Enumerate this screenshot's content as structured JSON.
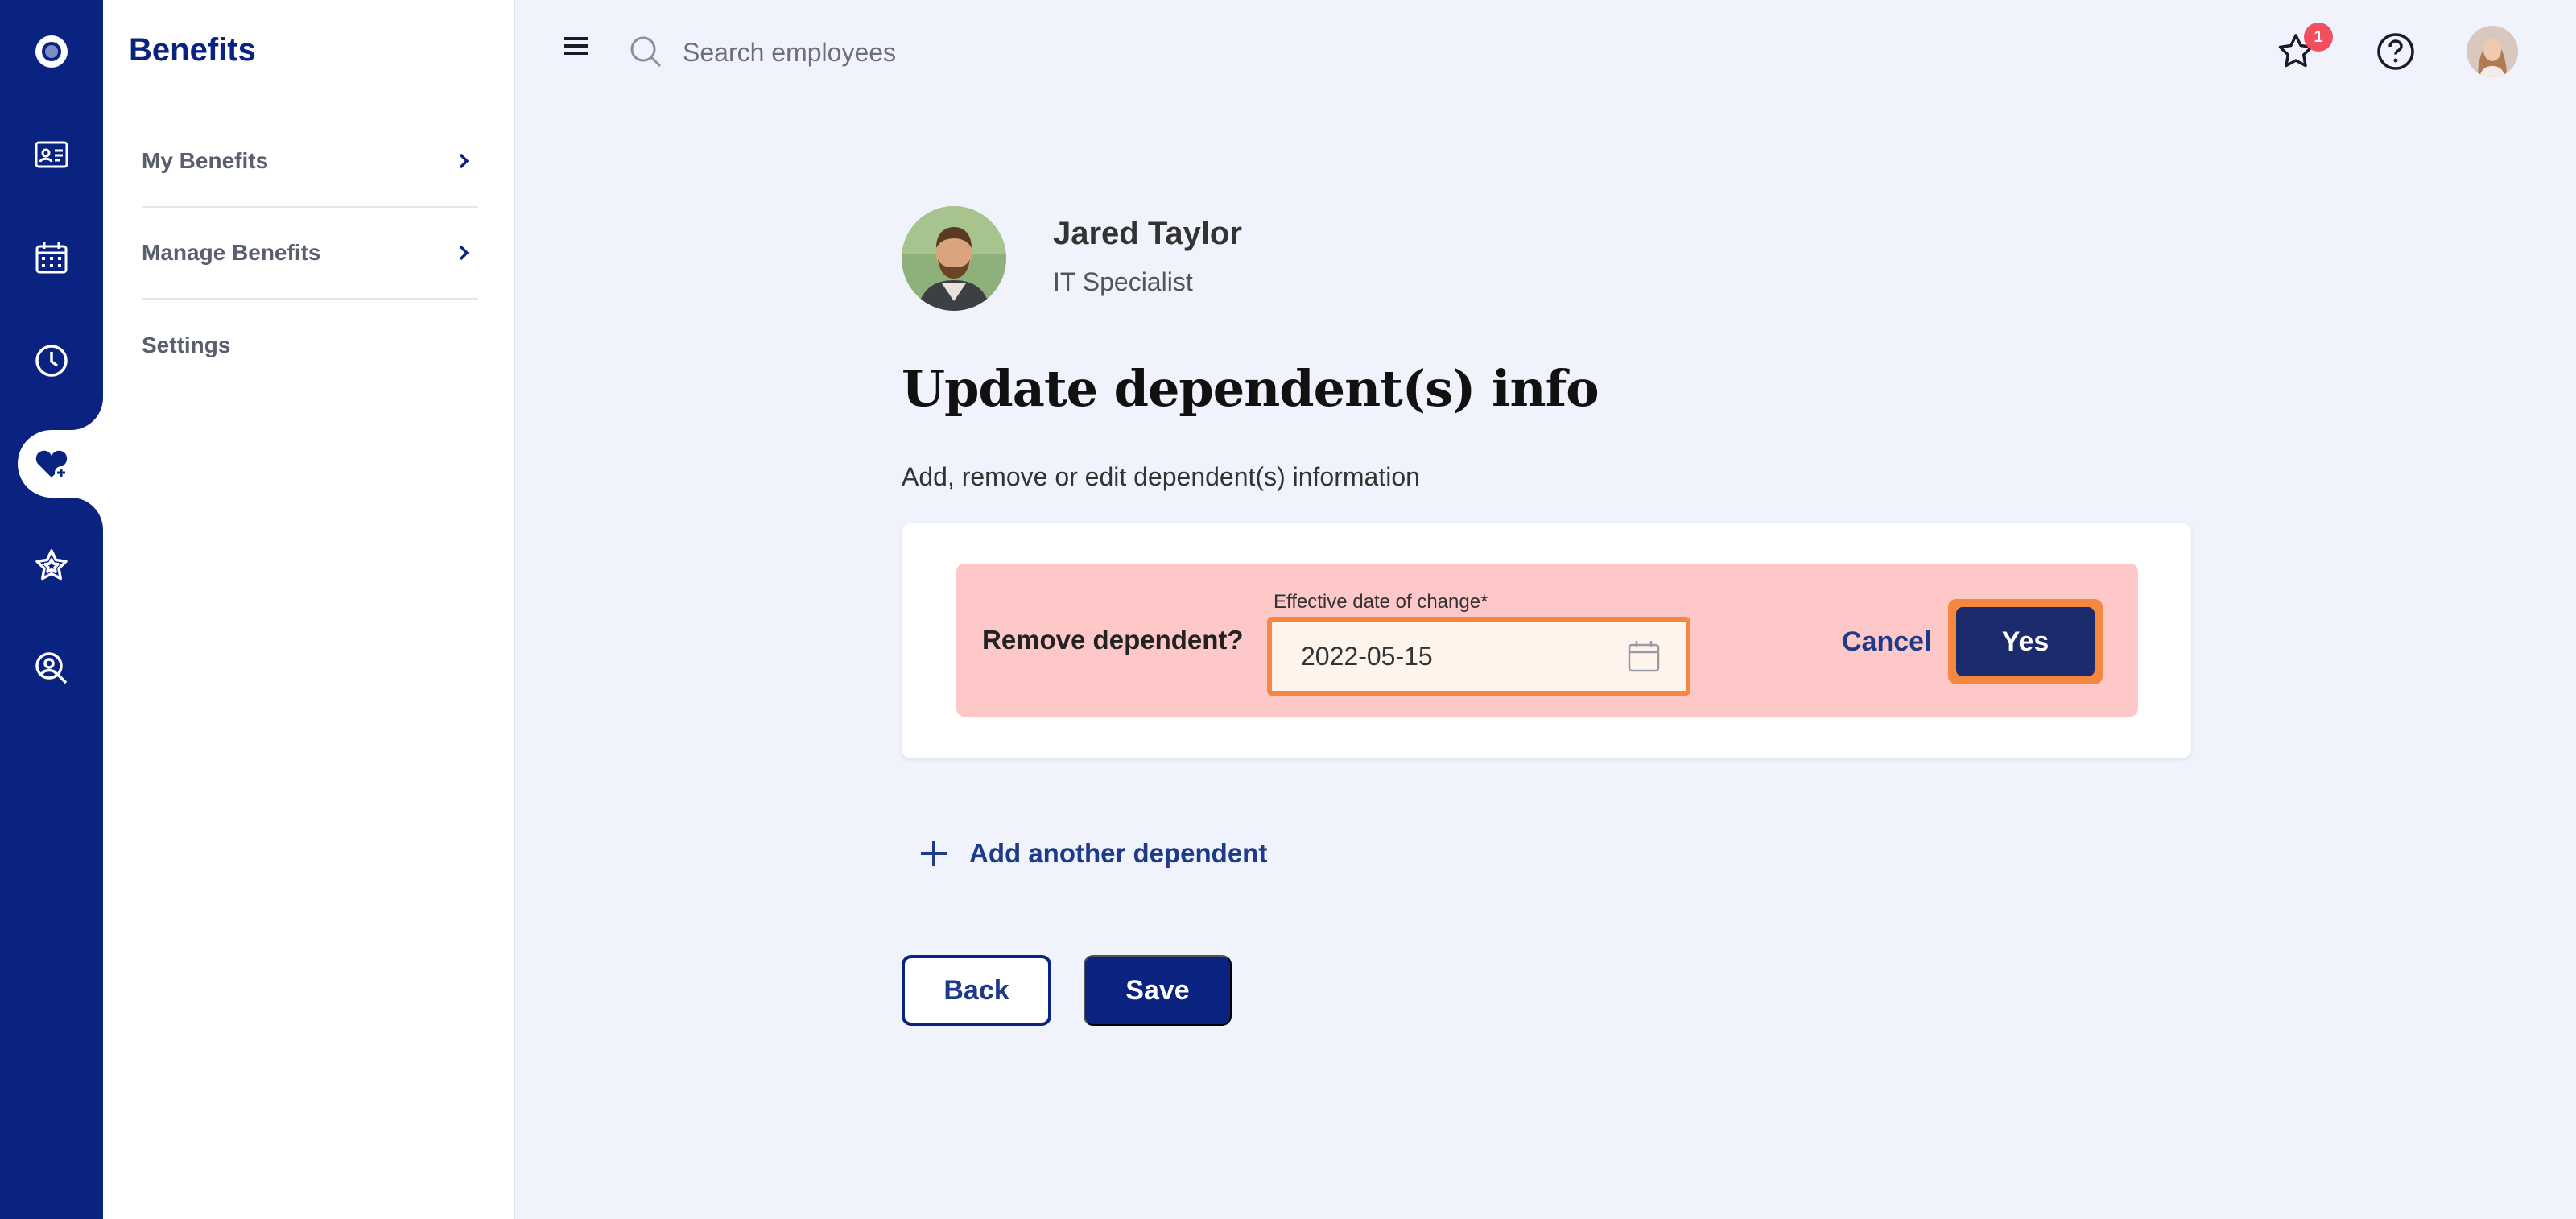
{
  "app": {
    "brand_color": "#0b2380",
    "rail_items": [
      {
        "icon": "app-logo-icon"
      },
      {
        "icon": "id-card-icon"
      },
      {
        "icon": "calendar-icon"
      },
      {
        "icon": "clock-icon"
      },
      {
        "icon": "heart-benefits-icon",
        "active": true
      },
      {
        "icon": "star-icon"
      },
      {
        "icon": "people-search-icon"
      }
    ]
  },
  "sidebar": {
    "title": "Benefits",
    "items": [
      {
        "label": "My Benefits",
        "has_chevron": true
      },
      {
        "label": "Manage Benefits",
        "has_chevron": true
      },
      {
        "label": "Settings",
        "has_chevron": false
      }
    ]
  },
  "topbar": {
    "search_placeholder": "Search employees",
    "notification_count": "1",
    "icons": [
      "menu-icon",
      "search-icon",
      "favorites-star-icon",
      "help-icon",
      "user-avatar"
    ]
  },
  "employee": {
    "name": "Jared Taylor",
    "role": "IT Specialist"
  },
  "page": {
    "title": "Update dependent(s) info",
    "subtitle": "Add, remove or edit dependent(s) information"
  },
  "remove_prompt": {
    "question": "Remove dependent?",
    "date_label": "Effective date of change*",
    "date_value": "2022-05-15",
    "cancel_label": "Cancel",
    "confirm_label": "Yes",
    "alert_bg": "#ffc8c8",
    "highlight_color": "#f58840"
  },
  "actions": {
    "add_dependent_label": "Add another dependent",
    "back_label": "Back",
    "save_label": "Save"
  }
}
